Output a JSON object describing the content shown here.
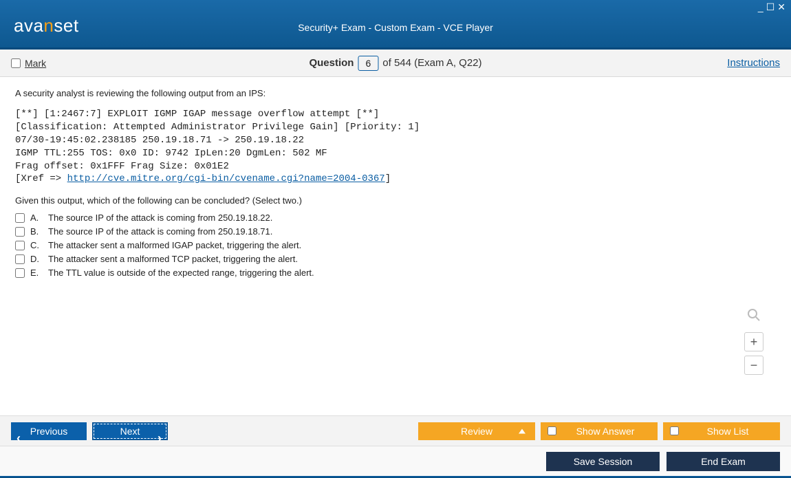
{
  "window": {
    "title": "Security+ Exam - Custom Exam - VCE Player",
    "logo_pre": "ava",
    "logo_mid": "n",
    "logo_post": "set"
  },
  "subbar": {
    "mark_label": "Mark",
    "question_label": "Question",
    "question_number": "6",
    "question_suffix": "of 544 (Exam A, Q22)",
    "instructions": "Instructions"
  },
  "question": {
    "prompt1": "A security analyst is reviewing the following output from an IPS:",
    "code_line1": "[**] [1:2467:7] EXPLOIT IGMP IGAP message overflow attempt [**]",
    "code_line2": "[Classification: Attempted Administrator Privilege Gain] [Priority: 1]",
    "code_line3": "07/30-19:45:02.238185 250.19.18.71 -> 250.19.18.22",
    "code_line4": "IGMP TTL:255 TOS: 0x0 ID: 9742 IpLen:20 DgmLen: 502 MF",
    "code_line5": "Frag offset: 0x1FFF Frag Size: 0x01E2",
    "code_line6_pre": "[Xref => ",
    "code_link": "http://cve.mitre.org/cgi-bin/cvename.cgi?name=2004-0367",
    "code_line6_post": "]",
    "prompt2": "Given this output, which of the following can be concluded? (Select two.)",
    "options": [
      {
        "letter": "A.",
        "text": "The source IP of the attack is coming from 250.19.18.22."
      },
      {
        "letter": "B.",
        "text": "The source IP of the attack is coming from 250.19.18.71."
      },
      {
        "letter": "C.",
        "text": "The attacker sent a malformed IGAP packet, triggering the alert."
      },
      {
        "letter": "D.",
        "text": "The attacker sent a malformed TCP packet, triggering the alert."
      },
      {
        "letter": "E.",
        "text": "The TTL value is outside of the expected range, triggering the alert."
      }
    ]
  },
  "nav": {
    "previous": "Previous",
    "next": "Next",
    "review": "Review",
    "show_answer": "Show Answer",
    "show_list": "Show List"
  },
  "bottom": {
    "save_session": "Save Session",
    "end_exam": "End Exam"
  },
  "zoom": {
    "plus": "+",
    "minus": "−"
  }
}
